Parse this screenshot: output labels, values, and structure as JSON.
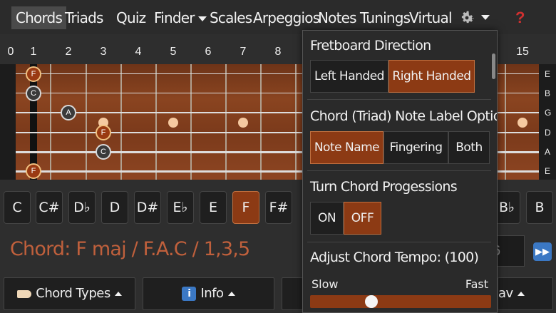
{
  "nav": {
    "items": [
      "Chords",
      "Triads",
      "Quiz",
      "Finder",
      "Scales",
      "Arpeggios",
      "Notes",
      "Tunings",
      "Virtual"
    ],
    "help_label": "?"
  },
  "fret_numbers": [
    "0",
    "1",
    "2",
    "3",
    "4",
    "5",
    "6",
    "7",
    "8",
    "15"
  ],
  "string_labels": [
    "E",
    "B",
    "G",
    "D",
    "A",
    "E"
  ],
  "notes": {
    "n1": "F",
    "n2": "C",
    "n3": "A",
    "n4": "F",
    "n5": "C",
    "n6": "F"
  },
  "keys": [
    "C",
    "C#",
    "D♭",
    "D",
    "D#",
    "E♭",
    "E",
    "F",
    "F#",
    "B♭",
    "B"
  ],
  "chord_display": "Chord: F maj / F.A.C / 1,3,5",
  "peek_value": "6",
  "bottom": {
    "chord_types": "Chord Types",
    "info": "Info",
    "info_icon": "i",
    "nav_tail": "av"
  },
  "panel": {
    "fretboard_direction": "Fretboard Direction",
    "left_handed": "Left Handed",
    "right_handed": "Right Handed",
    "label_options": "Chord (Triad) Note Label Options",
    "note_name": "Note Name",
    "fingering": "Fingering",
    "both": "Both",
    "progressions": "Turn Chord Progessions",
    "on": "ON",
    "off": "OFF",
    "tempo": "Adjust Chord Tempo: (100)",
    "slow": "Slow",
    "fast": "Fast",
    "tempo_level": 0.34
  },
  "colors": {
    "accent": "#8c3a14",
    "chord_text": "#c0603c",
    "help": "#d03030"
  }
}
